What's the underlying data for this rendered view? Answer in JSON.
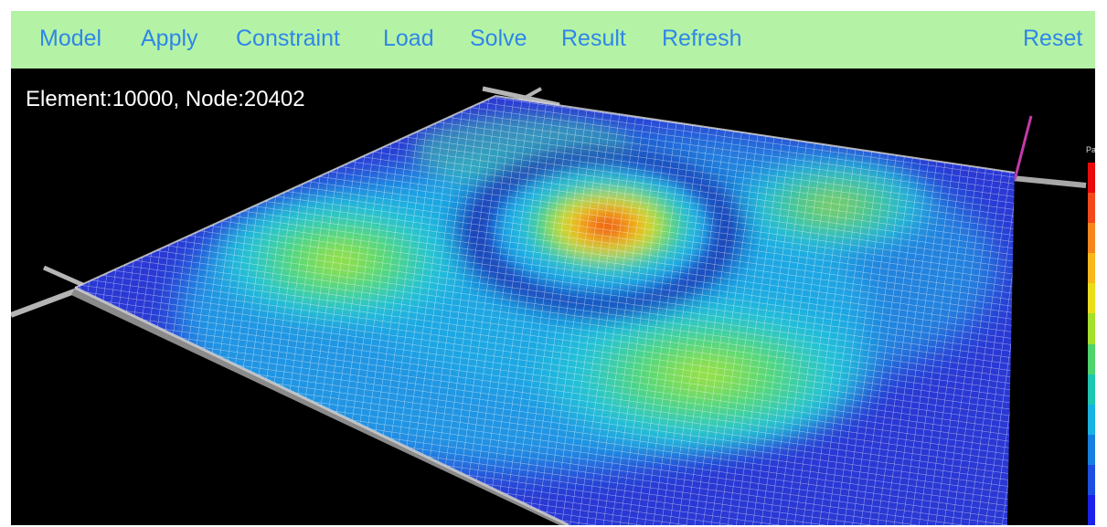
{
  "menu": {
    "model": "Model",
    "apply": "Apply",
    "constraint": "Constraint",
    "load": "Load",
    "solve": "Solve",
    "result": "Result",
    "refresh": "Refresh",
    "reset": "Reset"
  },
  "stats": {
    "element_label": "Element:",
    "element_count": "10000",
    "node_label": "Node:",
    "node_count": "20402"
  },
  "legend": {
    "unit": "Pa",
    "colors": [
      "#e80a0a",
      "#f1481c",
      "#f5861c",
      "#f8b81c",
      "#e9de19",
      "#a4e02c",
      "#4fd36d",
      "#1ec7b1",
      "#19b3e2",
      "#167fe0",
      "#1d4ee0",
      "#1a21e8"
    ]
  },
  "colors": {
    "toolbar_bg": "#b4f3a6",
    "menu_text": "#2f86e8",
    "viewport_bg": "#000000"
  }
}
